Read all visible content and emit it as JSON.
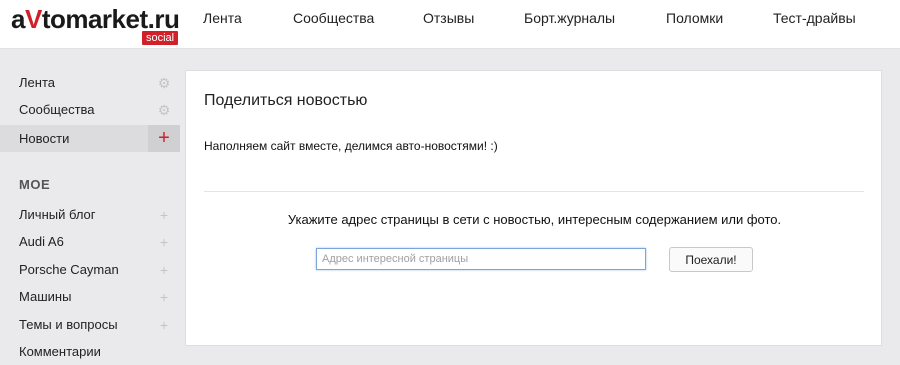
{
  "header": {
    "logo": {
      "prefix": "a",
      "v": "V",
      "suffix": "tomarket.ru",
      "badge": "social"
    },
    "nav": [
      "Лента",
      "Сообщества",
      "Отзывы",
      "Борт.журналы",
      "Поломки",
      "Тест-драйвы"
    ]
  },
  "sidebar": {
    "top_items": [
      {
        "label": "Лента",
        "icon": "gear-icon"
      },
      {
        "label": "Сообщества",
        "icon": "gear-icon"
      },
      {
        "label": "Новости",
        "icon": "plus-icon",
        "active": true
      }
    ],
    "section_title": "МОЕ",
    "my_items": [
      {
        "label": "Личный блог",
        "icon": "plus-icon"
      },
      {
        "label": "Audi A6",
        "icon": "plus-icon"
      },
      {
        "label": "Porsche Cayman",
        "icon": "plus-icon"
      },
      {
        "label": "Машины",
        "icon": "plus-icon"
      },
      {
        "label": "Темы и вопросы",
        "icon": "plus-icon"
      },
      {
        "label": "Комментарии"
      }
    ]
  },
  "main": {
    "title": "Поделиться новостью",
    "description": "Наполняем сайт вместе, делимся авто-новостями! :)",
    "instruction": "Укажите адрес страницы в сети с новостью, интересным содержанием или фото.",
    "url_input": {
      "placeholder": "Адрес интересной страницы",
      "value": ""
    },
    "submit_label": "Поехали!"
  },
  "colors": {
    "brand_red": "#d0202a",
    "background": "#eaeaec",
    "focus_blue": "#7aa7d8"
  }
}
